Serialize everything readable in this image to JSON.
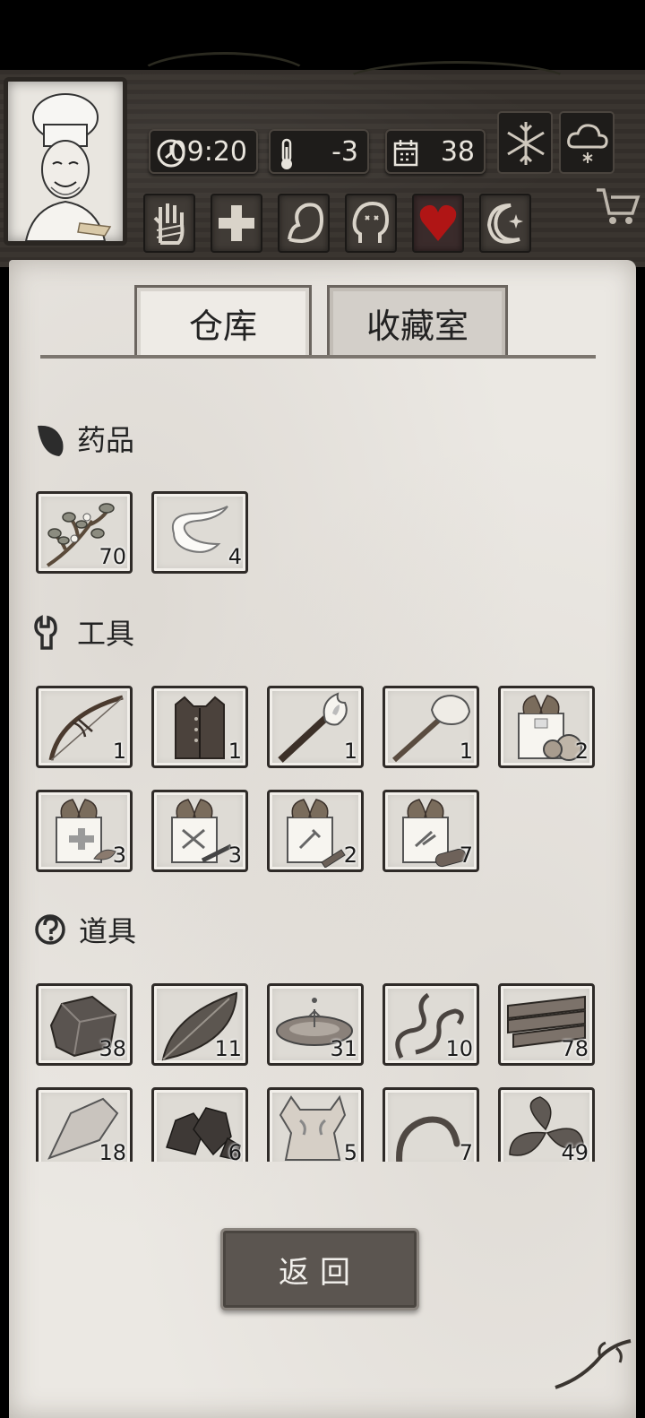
{
  "hud": {
    "time": "09:20",
    "temperature": "-3",
    "day": "38",
    "weather": [
      "snowflake-icon",
      "snow-cloud-icon"
    ],
    "stats": [
      "hand-icon",
      "health-cross-icon",
      "stomach-icon",
      "head-icon",
      "heart-icon",
      "moon-icon"
    ],
    "colors": {
      "heart": "#b01515",
      "wood": "#35302b",
      "paper": "#ebe8e3"
    }
  },
  "tabs": [
    {
      "label": "仓库",
      "active": true
    },
    {
      "label": "收藏室",
      "active": false
    }
  ],
  "sections": {
    "medicine": {
      "title": "药品",
      "items": [
        {
          "icon": "herb-icon",
          "count": "70"
        },
        {
          "icon": "bandage-icon",
          "count": "4"
        }
      ]
    },
    "tools": {
      "title": "工具",
      "items": [
        {
          "icon": "bow-icon",
          "count": "1"
        },
        {
          "icon": "vest-icon",
          "count": "1"
        },
        {
          "icon": "torch-icon",
          "count": "1"
        },
        {
          "icon": "hammer-icon",
          "count": "1"
        },
        {
          "icon": "food-box-icon",
          "count": "2"
        },
        {
          "icon": "medkit-box-icon",
          "count": "3"
        },
        {
          "icon": "weapon-box-icon",
          "count": "3"
        },
        {
          "icon": "tool-box-icon",
          "count": "2"
        },
        {
          "icon": "wood-box-icon",
          "count": "7"
        }
      ]
    },
    "props": {
      "title": "道具",
      "items": [
        {
          "icon": "stone-icon",
          "count": "38"
        },
        {
          "icon": "leaf-icon",
          "count": "11"
        },
        {
          "icon": "water-icon",
          "count": "31"
        },
        {
          "icon": "rope-icon",
          "count": "10"
        },
        {
          "icon": "planks-icon",
          "count": "78"
        },
        {
          "icon": "flint-icon",
          "count": "18"
        },
        {
          "icon": "ore-icon",
          "count": "6"
        },
        {
          "icon": "fur-icon",
          "count": "5"
        },
        {
          "icon": "worm-icon",
          "count": "7"
        },
        {
          "icon": "mint-icon",
          "count": "49"
        }
      ]
    }
  },
  "back_button": "返回"
}
